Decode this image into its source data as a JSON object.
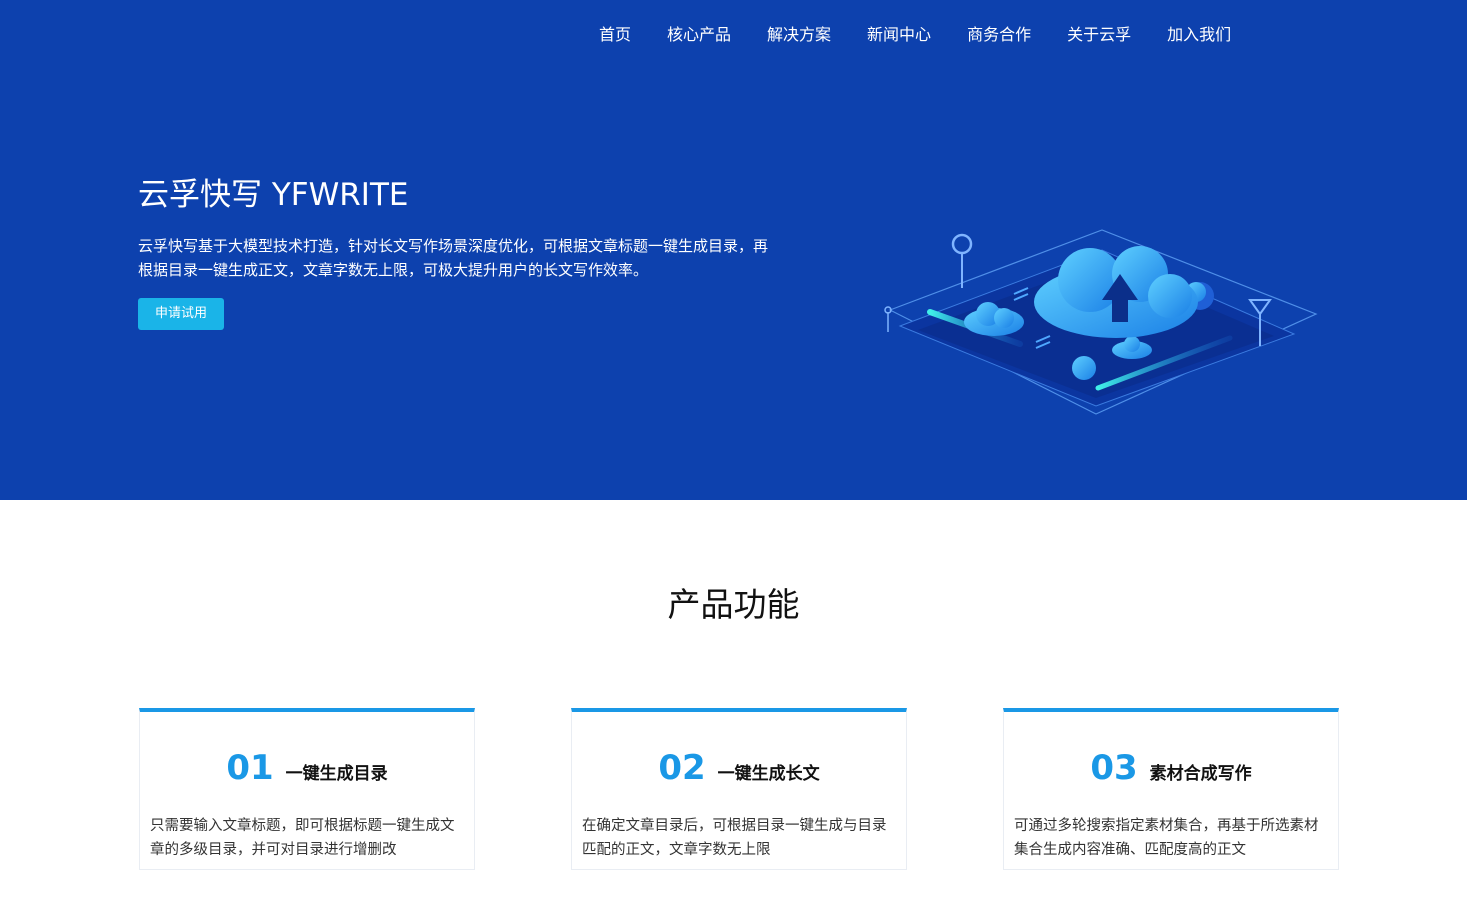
{
  "nav": {
    "items": [
      "首页",
      "核心产品",
      "解决方案",
      "新闻中心",
      "商务合作",
      "关于云孚",
      "加入我们"
    ]
  },
  "hero": {
    "title": "云孚快写 YFWRITE",
    "description": "云孚快写基于大模型技术打造，针对长文写作场景深度优化，可根据文章标题一键生成目录，再根据目录一键生成正文，文章字数无上限，可极大提升用户的长文写作效率。",
    "cta_label": "申请试用",
    "illustration_icon": "cloud-upload-isometric-illustration"
  },
  "features": {
    "title": "产品功能",
    "cards": [
      {
        "number": "01",
        "name": "一键生成目录",
        "text": "只需要输入文章标题，即可根据标题一键生成文章的多级目录，并可对目录进行增删改"
      },
      {
        "number": "02",
        "name": "一键生成长文",
        "text": "在确定文章目录后，可根据目录一键生成与目录匹配的正文，文章字数无上限"
      },
      {
        "number": "03",
        "name": "素材合成写作",
        "text": "可通过多轮搜索指定素材集合，再基于所选素材集合生成内容准确、匹配度高的正文"
      }
    ]
  },
  "colors": {
    "hero_bg": "#0d41ae",
    "accent": "#1a98e6",
    "cta_bg": "#1ab4e8"
  }
}
